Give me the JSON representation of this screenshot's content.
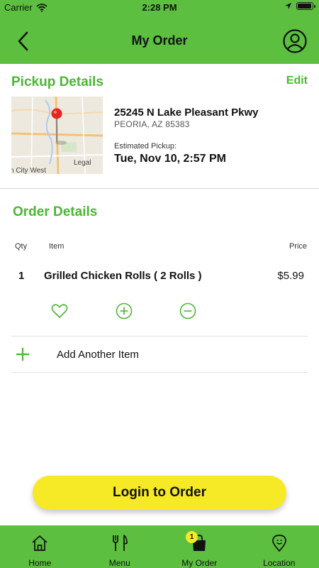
{
  "status_bar": {
    "carrier": "Carrier",
    "time": "2:28 PM",
    "battery_level": 0.95
  },
  "header": {
    "title": "My Order",
    "back_icon": "chevron-left-icon",
    "profile_icon": "user-circle-icon"
  },
  "pickup": {
    "title": "Pickup Details",
    "edit_label": "Edit",
    "map_labels": {
      "legal": "Legal",
      "city_fragment": "n City West"
    },
    "address_line1": "25245 N Lake Pleasant Pkwy",
    "address_line2": "PEORIA, AZ 85383",
    "estimated_label": "Estimated Pickup:",
    "estimated_time": "Tue, Nov 10, 2:57 PM"
  },
  "order": {
    "title": "Order Details",
    "columns": {
      "qty": "Qty",
      "item": "Item",
      "price": "Price"
    },
    "items": [
      {
        "qty": "1",
        "name": "Grilled Chicken Rolls ( 2 Rolls )",
        "price": "$5.99"
      }
    ],
    "add_another_label": "Add Another Item"
  },
  "login_button_label": "Login to Order",
  "tabbar": {
    "tabs": [
      {
        "label": "Home",
        "icon": "home-icon"
      },
      {
        "label": "Menu",
        "icon": "fork-knife-icon"
      },
      {
        "label": "My Order",
        "icon": "bag-icon",
        "badge": "1"
      },
      {
        "label": "Location",
        "icon": "location-pin-icon"
      }
    ]
  },
  "colors": {
    "brand_green": "#5cbf3f",
    "text_green": "#4cb635",
    "button_yellow": "#f6ea26"
  }
}
